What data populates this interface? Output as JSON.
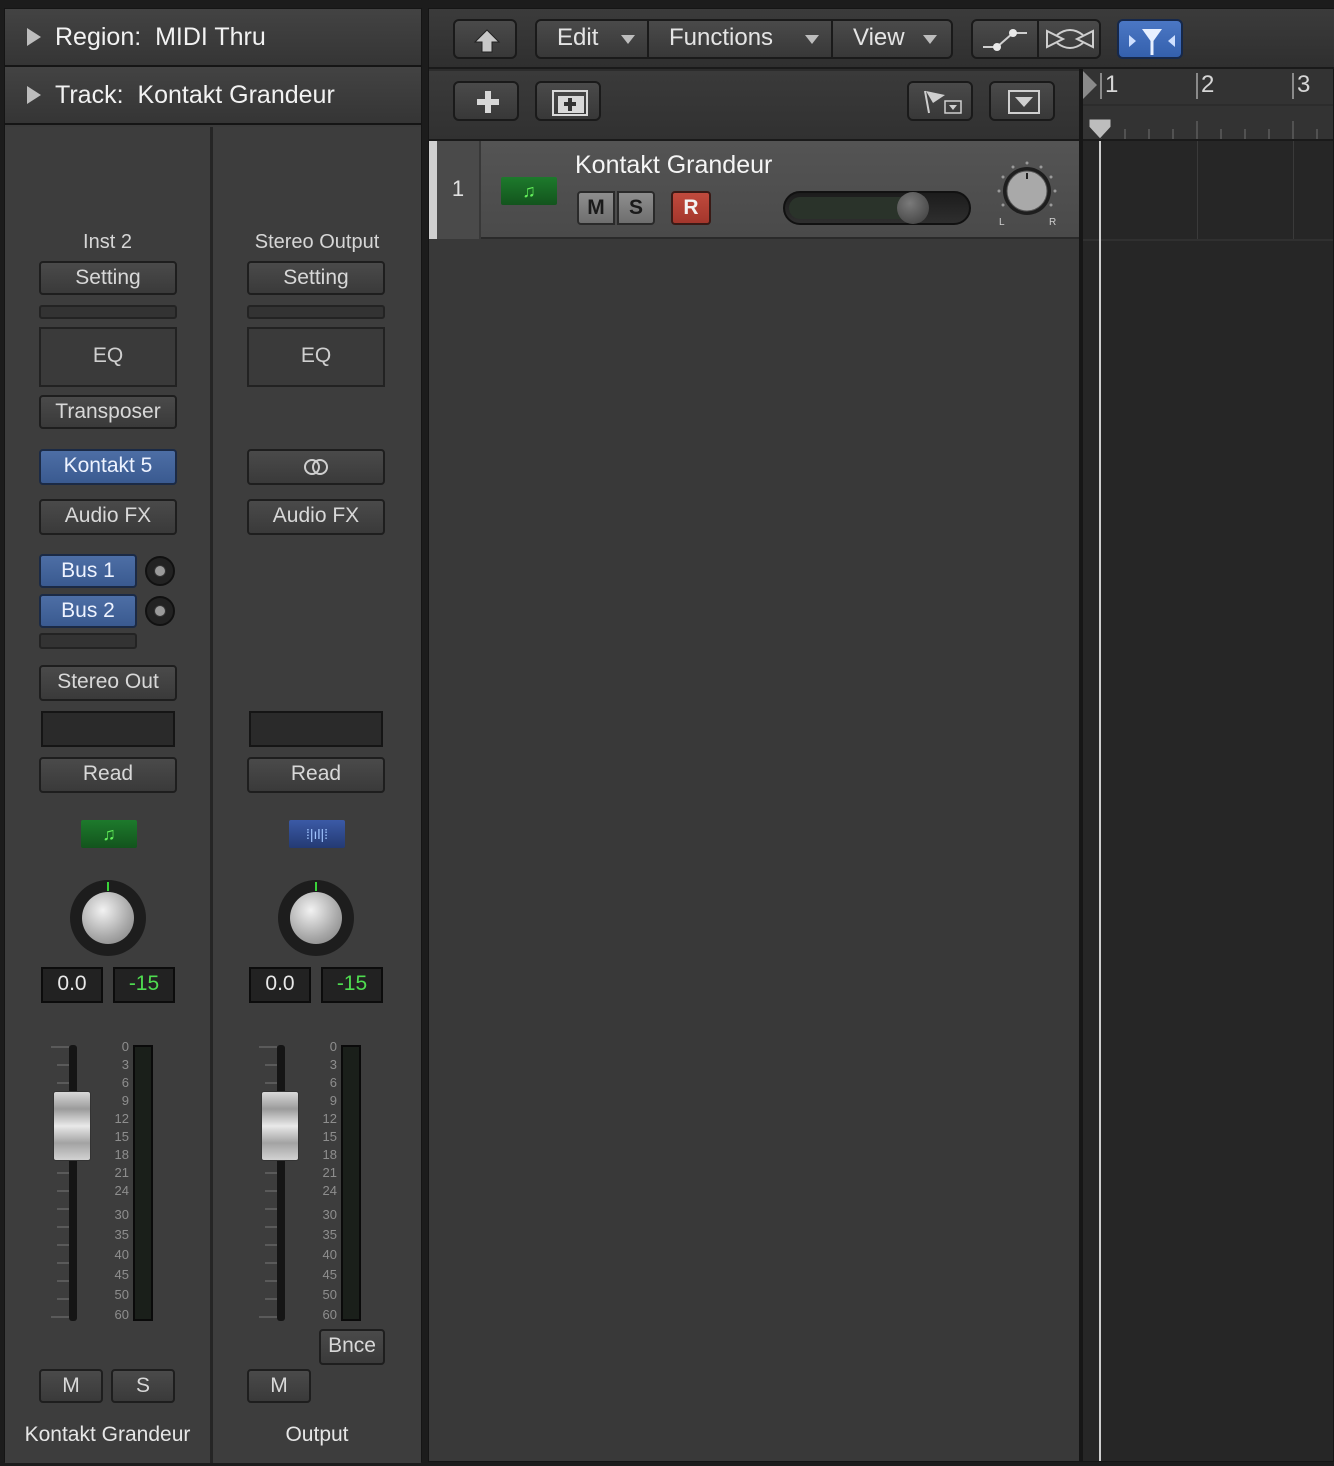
{
  "inspector": {
    "region_label": "Region:",
    "region_value": "MIDI Thru",
    "track_label": "Track:",
    "track_value": "Kontakt Grandeur"
  },
  "strip1": {
    "io_label": "Inst 2",
    "setting": "Setting",
    "eq": "EQ",
    "midi_fx": "Transposer",
    "instrument": "Kontakt 5",
    "audio_fx": "Audio FX",
    "sends": [
      "Bus 1",
      "Bus 2"
    ],
    "output": "Stereo Out",
    "automation": "Read",
    "volume": "0.0",
    "peak": "-15",
    "mute": "M",
    "solo": "S",
    "name": "Kontakt Grandeur"
  },
  "strip2": {
    "io_label": "Stereo Output",
    "setting": "Setting",
    "eq": "EQ",
    "link_icon": "stereo-link-icon",
    "audio_fx": "Audio FX",
    "automation": "Read",
    "volume": "0.0",
    "peak": "-15",
    "bounce": "Bnce",
    "mute": "M",
    "name": "Output"
  },
  "meter_scale": [
    "0",
    "3",
    "6",
    "9",
    "12",
    "15",
    "18",
    "21",
    "24",
    "30",
    "35",
    "40",
    "45",
    "50",
    "60"
  ],
  "toolbar": {
    "menus": [
      "Edit",
      "Functions",
      "View"
    ]
  },
  "ruler": {
    "bars": [
      "1",
      "2",
      "3"
    ]
  },
  "track": {
    "number": "1",
    "name": "Kontakt Grandeur",
    "mute": "M",
    "solo": "S",
    "record": "R",
    "pan_l": "L",
    "pan_r": "R"
  },
  "colors": {
    "instrument_green": "#1d7a2c",
    "plugin_blue": "#4d6ea5",
    "record_red": "#c04a3d",
    "meter_green": "#4fdc50"
  }
}
